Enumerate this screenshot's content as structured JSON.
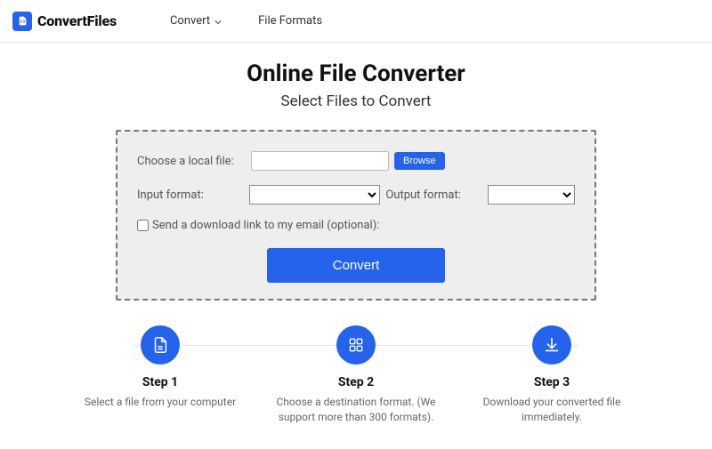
{
  "brand": "ConvertFiles",
  "nav": {
    "convert": "Convert",
    "formats": "File Formats"
  },
  "hero": {
    "title": "Online File Converter",
    "subtitle": "Select Files to Convert"
  },
  "panel": {
    "choose_label": "Choose a local file:",
    "browse": "Browse",
    "input_format_label": "Input format:",
    "output_format_label": "Output format:",
    "email_checkbox_label": "Send a download link to my email (optional):",
    "convert": "Convert"
  },
  "steps": [
    {
      "title": "Step 1",
      "desc": "Select a file from your computer"
    },
    {
      "title": "Step 2",
      "desc": "Choose a destination format. (We support more than 300 formats)."
    },
    {
      "title": "Step 3",
      "desc": "Download your converted file immediately."
    }
  ]
}
